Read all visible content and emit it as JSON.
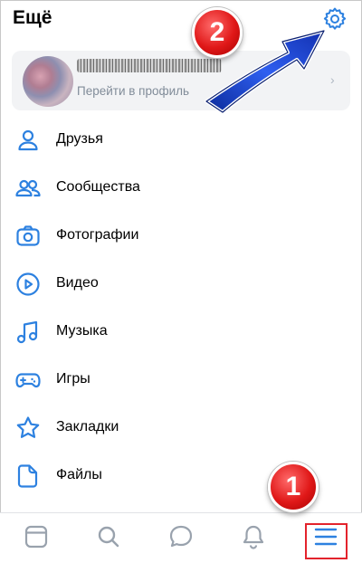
{
  "header": {
    "title": "Ещё"
  },
  "icons": {
    "settings": "gear-icon",
    "chevron": "chevron-right-icon"
  },
  "profile": {
    "link_label": "Перейти в профиль",
    "chevron": "›"
  },
  "menu": {
    "items": [
      {
        "label": "Друзья",
        "icon": "user-icon"
      },
      {
        "label": "Сообщества",
        "icon": "users-icon"
      },
      {
        "label": "Фотографии",
        "icon": "camera-icon"
      },
      {
        "label": "Видео",
        "icon": "play-icon"
      },
      {
        "label": "Музыка",
        "icon": "music-note-icon"
      },
      {
        "label": "Игры",
        "icon": "gamepad-icon"
      },
      {
        "label": "Закладки",
        "icon": "star-icon"
      },
      {
        "label": "Файлы",
        "icon": "file-icon"
      }
    ]
  },
  "tabbar": {
    "tabs": [
      "news-icon",
      "search-icon",
      "messages-icon",
      "bell-icon",
      "hamburger-menu-icon"
    ]
  },
  "annotations": {
    "badge_1": "1",
    "badge_2": "2"
  },
  "colors": {
    "accent": "#2d81e0",
    "annotation_red": "#e01818",
    "arrow_blue": "#1a3fc4"
  }
}
